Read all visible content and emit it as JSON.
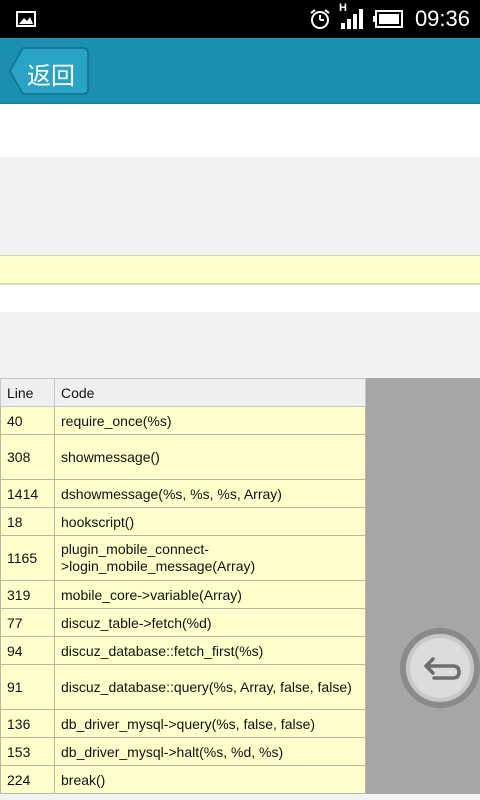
{
  "status_bar": {
    "time": "09:36",
    "network_label": "H",
    "icons": [
      "image-icon",
      "alarm-icon",
      "signal-icon",
      "battery-icon"
    ]
  },
  "header": {
    "back_label": "返回",
    "color": "#1a8fb0"
  },
  "table": {
    "headers": {
      "line": "Line",
      "code": "Code"
    },
    "rows": [
      {
        "line": "40",
        "code": "require_once(%s)"
      },
      {
        "line": "308",
        "code": "showmessage()"
      },
      {
        "line": "1414",
        "code": "dshowmessage(%s, %s, %s, Array)"
      },
      {
        "line": "18",
        "code": "hookscript()"
      },
      {
        "line": "1165",
        "code": "plugin_mobile_connect->login_mobile_message(Array)"
      },
      {
        "line": "319",
        "code": "mobile_core->variable(Array)"
      },
      {
        "line": "77",
        "code": "discuz_table->fetch(%d)"
      },
      {
        "line": "94",
        "code": "discuz_database::fetch_first(%s)"
      },
      {
        "line": "91",
        "code": "discuz_database::query(%s, Array, false, false)"
      },
      {
        "line": "136",
        "code": "db_driver_mysql->query(%s, false, false)"
      },
      {
        "line": "153",
        "code": "db_driver_mysql->halt(%s, %d, %s)"
      },
      {
        "line": "224",
        "code": "break()"
      }
    ],
    "row_bg": "#ffffcc"
  },
  "floating_button": {
    "icon": "return-arrow-icon"
  }
}
